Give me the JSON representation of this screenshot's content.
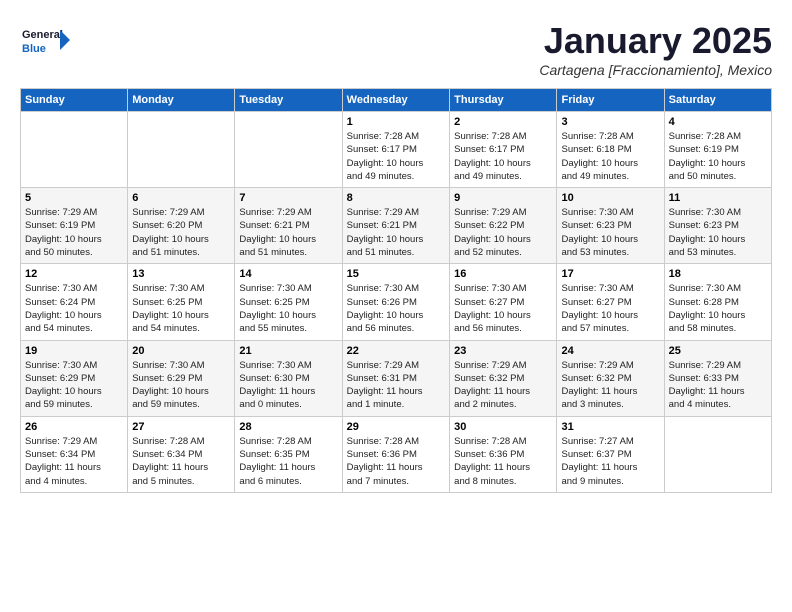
{
  "header": {
    "logo_general": "General",
    "logo_blue": "Blue",
    "month_title": "January 2025",
    "subtitle": "Cartagena [Fraccionamiento], Mexico"
  },
  "days_of_week": [
    "Sunday",
    "Monday",
    "Tuesday",
    "Wednesday",
    "Thursday",
    "Friday",
    "Saturday"
  ],
  "weeks": [
    [
      {
        "day": null,
        "info": null
      },
      {
        "day": null,
        "info": null
      },
      {
        "day": null,
        "info": null
      },
      {
        "day": "1",
        "info": "Sunrise: 7:28 AM\nSunset: 6:17 PM\nDaylight: 10 hours\nand 49 minutes."
      },
      {
        "day": "2",
        "info": "Sunrise: 7:28 AM\nSunset: 6:17 PM\nDaylight: 10 hours\nand 49 minutes."
      },
      {
        "day": "3",
        "info": "Sunrise: 7:28 AM\nSunset: 6:18 PM\nDaylight: 10 hours\nand 49 minutes."
      },
      {
        "day": "4",
        "info": "Sunrise: 7:28 AM\nSunset: 6:19 PM\nDaylight: 10 hours\nand 50 minutes."
      }
    ],
    [
      {
        "day": "5",
        "info": "Sunrise: 7:29 AM\nSunset: 6:19 PM\nDaylight: 10 hours\nand 50 minutes."
      },
      {
        "day": "6",
        "info": "Sunrise: 7:29 AM\nSunset: 6:20 PM\nDaylight: 10 hours\nand 51 minutes."
      },
      {
        "day": "7",
        "info": "Sunrise: 7:29 AM\nSunset: 6:21 PM\nDaylight: 10 hours\nand 51 minutes."
      },
      {
        "day": "8",
        "info": "Sunrise: 7:29 AM\nSunset: 6:21 PM\nDaylight: 10 hours\nand 51 minutes."
      },
      {
        "day": "9",
        "info": "Sunrise: 7:29 AM\nSunset: 6:22 PM\nDaylight: 10 hours\nand 52 minutes."
      },
      {
        "day": "10",
        "info": "Sunrise: 7:30 AM\nSunset: 6:23 PM\nDaylight: 10 hours\nand 53 minutes."
      },
      {
        "day": "11",
        "info": "Sunrise: 7:30 AM\nSunset: 6:23 PM\nDaylight: 10 hours\nand 53 minutes."
      }
    ],
    [
      {
        "day": "12",
        "info": "Sunrise: 7:30 AM\nSunset: 6:24 PM\nDaylight: 10 hours\nand 54 minutes."
      },
      {
        "day": "13",
        "info": "Sunrise: 7:30 AM\nSunset: 6:25 PM\nDaylight: 10 hours\nand 54 minutes."
      },
      {
        "day": "14",
        "info": "Sunrise: 7:30 AM\nSunset: 6:25 PM\nDaylight: 10 hours\nand 55 minutes."
      },
      {
        "day": "15",
        "info": "Sunrise: 7:30 AM\nSunset: 6:26 PM\nDaylight: 10 hours\nand 56 minutes."
      },
      {
        "day": "16",
        "info": "Sunrise: 7:30 AM\nSunset: 6:27 PM\nDaylight: 10 hours\nand 56 minutes."
      },
      {
        "day": "17",
        "info": "Sunrise: 7:30 AM\nSunset: 6:27 PM\nDaylight: 10 hours\nand 57 minutes."
      },
      {
        "day": "18",
        "info": "Sunrise: 7:30 AM\nSunset: 6:28 PM\nDaylight: 10 hours\nand 58 minutes."
      }
    ],
    [
      {
        "day": "19",
        "info": "Sunrise: 7:30 AM\nSunset: 6:29 PM\nDaylight: 10 hours\nand 59 minutes."
      },
      {
        "day": "20",
        "info": "Sunrise: 7:30 AM\nSunset: 6:29 PM\nDaylight: 10 hours\nand 59 minutes."
      },
      {
        "day": "21",
        "info": "Sunrise: 7:30 AM\nSunset: 6:30 PM\nDaylight: 11 hours\nand 0 minutes."
      },
      {
        "day": "22",
        "info": "Sunrise: 7:29 AM\nSunset: 6:31 PM\nDaylight: 11 hours\nand 1 minute."
      },
      {
        "day": "23",
        "info": "Sunrise: 7:29 AM\nSunset: 6:32 PM\nDaylight: 11 hours\nand 2 minutes."
      },
      {
        "day": "24",
        "info": "Sunrise: 7:29 AM\nSunset: 6:32 PM\nDaylight: 11 hours\nand 3 minutes."
      },
      {
        "day": "25",
        "info": "Sunrise: 7:29 AM\nSunset: 6:33 PM\nDaylight: 11 hours\nand 4 minutes."
      }
    ],
    [
      {
        "day": "26",
        "info": "Sunrise: 7:29 AM\nSunset: 6:34 PM\nDaylight: 11 hours\nand 4 minutes."
      },
      {
        "day": "27",
        "info": "Sunrise: 7:28 AM\nSunset: 6:34 PM\nDaylight: 11 hours\nand 5 minutes."
      },
      {
        "day": "28",
        "info": "Sunrise: 7:28 AM\nSunset: 6:35 PM\nDaylight: 11 hours\nand 6 minutes."
      },
      {
        "day": "29",
        "info": "Sunrise: 7:28 AM\nSunset: 6:36 PM\nDaylight: 11 hours\nand 7 minutes."
      },
      {
        "day": "30",
        "info": "Sunrise: 7:28 AM\nSunset: 6:36 PM\nDaylight: 11 hours\nand 8 minutes."
      },
      {
        "day": "31",
        "info": "Sunrise: 7:27 AM\nSunset: 6:37 PM\nDaylight: 11 hours\nand 9 minutes."
      },
      {
        "day": null,
        "info": null
      }
    ]
  ]
}
